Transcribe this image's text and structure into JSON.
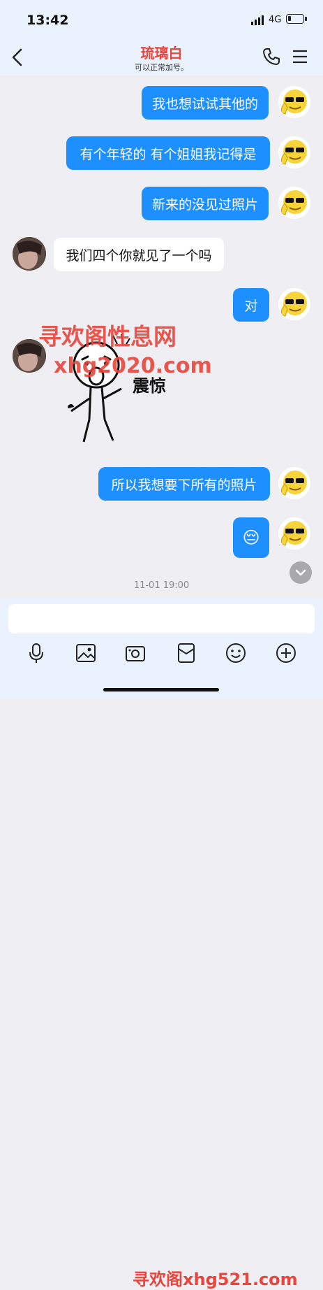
{
  "status_bar": {
    "time": "13:42",
    "network": "4G",
    "battery_level": 0.2
  },
  "header": {
    "title": "琉璃白",
    "subtitle": "可以正常加号。"
  },
  "messages": [
    {
      "side": "right",
      "type": "text",
      "text": "我也想试试其他的"
    },
    {
      "side": "right",
      "type": "text",
      "text": "有个年轻的 有个姐姐我记得是"
    },
    {
      "side": "right",
      "type": "text",
      "text": "新来的没见过照片"
    },
    {
      "side": "left",
      "type": "text",
      "text": "我们四个你就见了一个吗"
    },
    {
      "side": "right",
      "type": "text",
      "text": "对"
    },
    {
      "side": "left",
      "type": "sticker",
      "text": "震惊"
    },
    {
      "side": "right",
      "type": "text",
      "text": "所以我想要下所有的照片"
    },
    {
      "side": "right",
      "type": "emoji",
      "text": "😔"
    }
  ],
  "timestamp": "11-01 19:00",
  "watermarks": {
    "line1": "寻欢阁性息网",
    "line2": "xhg2020.com",
    "bottom": "寻欢阁xhg521.com"
  },
  "toolbar": [
    "microphone-icon",
    "image-icon",
    "camera-icon",
    "red-packet-icon",
    "emoji-icon",
    "plus-icon"
  ]
}
